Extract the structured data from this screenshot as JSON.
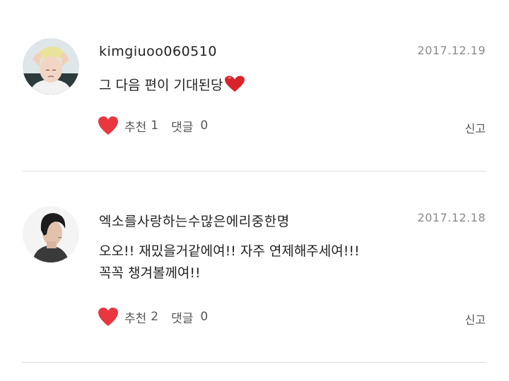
{
  "comments": [
    {
      "username": "kimgiuoo060510",
      "date": "2017.12.19",
      "body_lines": [
        "그 다음 편이 기대된당"
      ],
      "body_emoji": "heart-emoji",
      "like_label": "추천",
      "like_count": "1",
      "reply_label": "댓글",
      "reply_count": "0",
      "report_label": "신고"
    },
    {
      "username": "엑소를사랑하는수많은에리중한명",
      "date": "2017.12.18",
      "body_lines": [
        "오오!! 재밌을거같에여!! 자주 연제해주세여!!!",
        "꼭꼭 챙겨볼께여!!"
      ],
      "like_label": "추천",
      "like_count": "2",
      "reply_label": "댓글",
      "reply_count": "0",
      "report_label": "신고"
    }
  ],
  "colors": {
    "heart": "#e8373e",
    "date": "#8a8a8a",
    "divider": "#dddddd"
  }
}
